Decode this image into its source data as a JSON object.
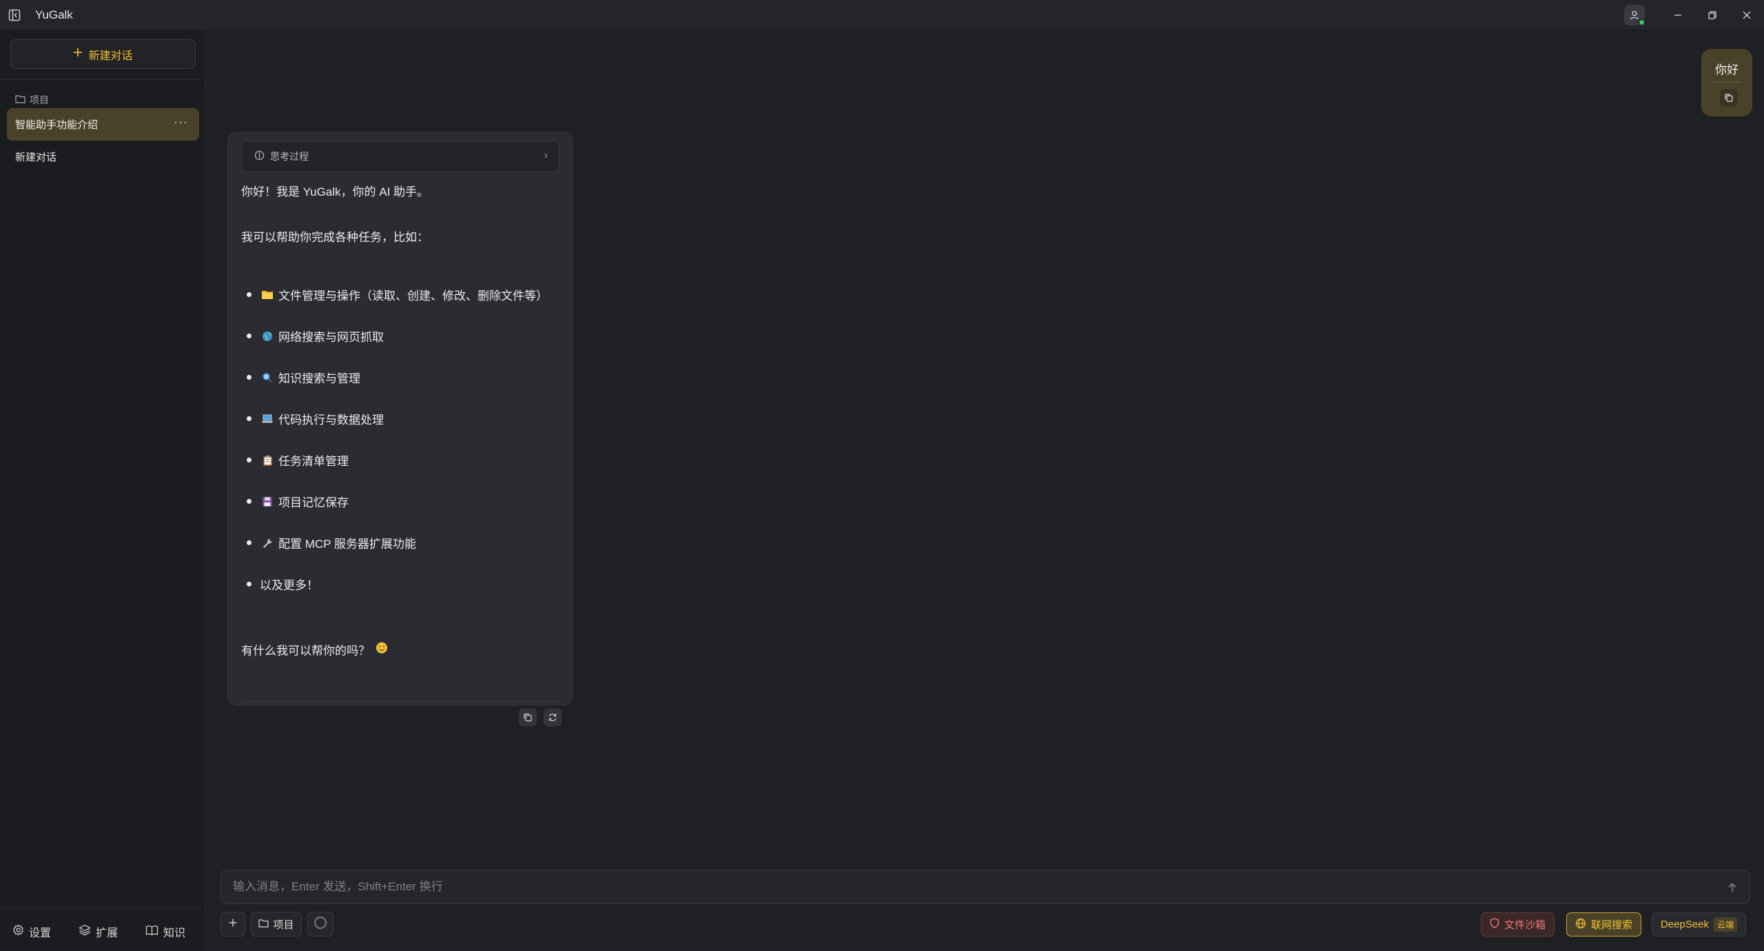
{
  "app": {
    "title": "YuGalk"
  },
  "sidebar": {
    "new_chat_label": "新建对话",
    "projects_label": "项目",
    "conversations": [
      {
        "title": "智能助手功能介绍",
        "active": true
      },
      {
        "title": "新建对话",
        "active": false
      }
    ],
    "bottom": {
      "settings": "设置",
      "extensions": "扩展",
      "knowledge": "知识"
    }
  },
  "chat": {
    "user_message": "你好",
    "assistant": {
      "thinking_label": "思考过程",
      "intro": "你好！我是 YuGalk，你的 AI 助手。",
      "lead": "我可以帮助你完成各种任务，比如：",
      "items": [
        {
          "icon": "folder",
          "text": "文件管理与操作（读取、创建、修改、删除文件等）"
        },
        {
          "icon": "globe",
          "text": "网络搜索与网页抓取"
        },
        {
          "icon": "magnifier",
          "text": "知识搜索与管理"
        },
        {
          "icon": "laptop",
          "text": "代码执行与数据处理"
        },
        {
          "icon": "clipboard",
          "text": "任务清单管理"
        },
        {
          "icon": "floppy-disk",
          "text": "项目记忆保存"
        },
        {
          "icon": "wrench",
          "text": "配置 MCP 服务器扩展功能"
        },
        {
          "icon": "",
          "text": "以及更多！"
        }
      ],
      "closing": "有什么我可以帮你的吗？"
    }
  },
  "composer": {
    "placeholder": "输入消息，Enter 发送，Shift+Enter 换行",
    "project_label": "项目",
    "sandbox_label": "文件沙箱",
    "web_search_label": "联网搜索",
    "model_name": "DeepSeek",
    "model_tag": "云端"
  },
  "colors": {
    "accent": "#f1c232",
    "active_bg": "#4a4228",
    "danger": "#f07a7a"
  }
}
